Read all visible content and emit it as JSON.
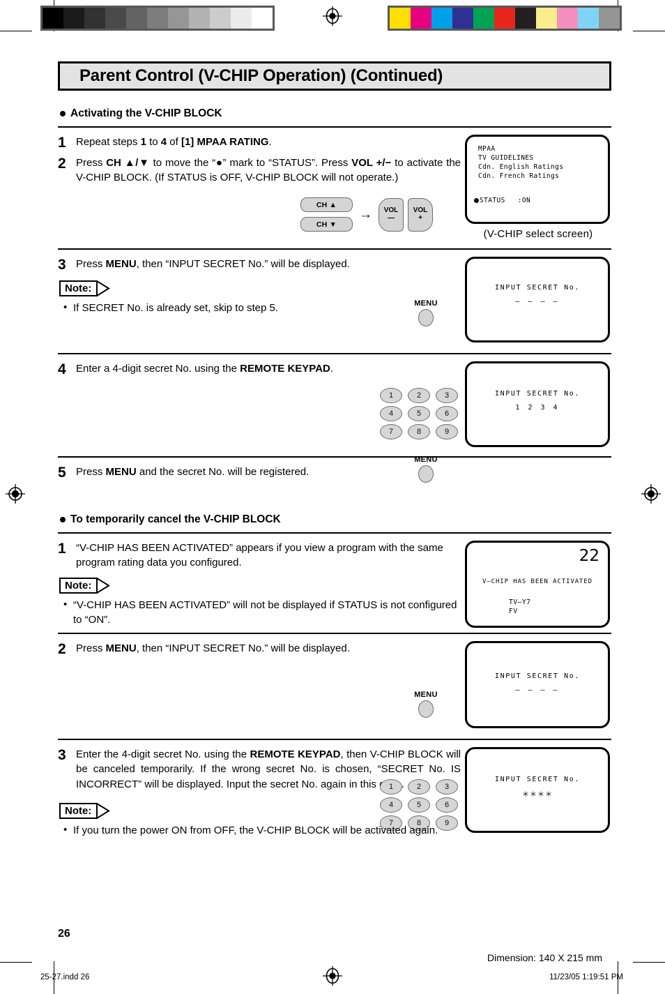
{
  "document": {
    "title": "Parent Control (V-CHIP Operation) (Continued)",
    "page_number": "26",
    "dimension_note": "Dimension: 140  X 215 mm",
    "footer_file": "25-27.indd   26",
    "footer_date": "11/23/05   1:19:51 PM"
  },
  "color_bars": {
    "grayscale": [
      "#000000",
      "#1b1b1b",
      "#323232",
      "#4a4a4a",
      "#636363",
      "#7d7d7d",
      "#969696",
      "#b3b3b3",
      "#cccccc",
      "#ebebeb",
      "#ffffff"
    ],
    "color": [
      "#ffe000",
      "#e6007e",
      "#00a0e9",
      "#2e3192",
      "#00a353",
      "#e8251c",
      "#231f20",
      "#faee8c",
      "#f48fc0",
      "#7fd4f5",
      "#959595"
    ]
  },
  "sections": [
    {
      "heading": "Activating the V-CHIP BLOCK",
      "steps": [
        {
          "number": "1",
          "text_parts": [
            {
              "t": "Repeat steps ",
              "b": false
            },
            {
              "t": "1",
              "b": true
            },
            {
              "t": " to ",
              "b": false
            },
            {
              "t": "4",
              "b": true
            },
            {
              "t": " of ",
              "b": false
            },
            {
              "t": "[1] MPAA RATING",
              "b": true
            },
            {
              "t": ".",
              "b": false
            }
          ]
        },
        {
          "number": "2",
          "text_parts": [
            {
              "t": "Press ",
              "b": false
            },
            {
              "t": "CH ▲/▼",
              "b": true
            },
            {
              "t": " to move the “●” mark to “STATUS”. Press ",
              "b": false
            },
            {
              "t": "VOL +/−",
              "b": true
            },
            {
              "t": "  to activate the V-CHIP BLOCK. (If STATUS is OFF, V-CHIP BLOCK will not operate.)",
              "b": false
            }
          ]
        }
      ],
      "controls": {
        "ch_up_label": "CH ▲",
        "ch_down_label": "CH ▼",
        "arrow": "→",
        "vol_minus_label": "VOL",
        "vol_minus_sign": "—",
        "vol_plus_label": "VOL",
        "vol_plus_sign": "+"
      },
      "screen": {
        "menu_lines": "MPAA\nTV GUIDELINES\nCdn. English Ratings\nCdn. French Ratings",
        "status_label": "STATUS",
        "status_value": ":ON",
        "caption": "(V-CHIP select screen)"
      }
    }
  ],
  "step3": {
    "number": "3",
    "text_parts": [
      {
        "t": "Press ",
        "b": false
      },
      {
        "t": "MENU",
        "b": true
      },
      {
        "t": ", then “INPUT SECRET No.” will be displayed.",
        "b": false
      }
    ],
    "note_label": "Note:",
    "note_items": [
      "If SECRET No. is already set, skip to step 5."
    ],
    "menu_button_label": "MENU",
    "screen": {
      "line1": "INPUT SECRET No.",
      "line2": "– – – –"
    }
  },
  "step4": {
    "number": "4",
    "text_parts": [
      {
        "t": "Enter a 4-digit secret No. using the ",
        "b": false
      },
      {
        "t": "REMOTE KEYPAD",
        "b": true
      },
      {
        "t": ".",
        "b": false
      }
    ],
    "keypad_keys": [
      "1",
      "2",
      "3",
      "4",
      "5",
      "6",
      "7",
      "8",
      "9"
    ],
    "screen": {
      "line1": "INPUT SECRET No.",
      "line2": "1 2 3 4"
    }
  },
  "step5": {
    "number": "5",
    "text_parts": [
      {
        "t": "Press ",
        "b": false
      },
      {
        "t": "MENU",
        "b": true
      },
      {
        "t": " and the secret No. will be registered.",
        "b": false
      }
    ],
    "menu_button_label": "MENU"
  },
  "section2": {
    "heading": "To temporarily cancel the V-CHIP BLOCK"
  },
  "s2step1": {
    "number": "1",
    "text_parts": [
      {
        "t": "“V-CHIP HAS BEEN ACTIVATED” appears if you view a program with the same program rating data you configured.",
        "b": false
      }
    ],
    "note_label": "Note:",
    "note_items": [
      "“V-CHIP HAS BEEN ACTIVATED” will not be displayed if STATUS is not configured to “ON”."
    ],
    "screen": {
      "channel": "22",
      "line1": "V–CHIP HAS BEEN ACTIVATED",
      "line2": "TV–Y7",
      "line3": "FV"
    }
  },
  "s2step2": {
    "number": "2",
    "text_parts": [
      {
        "t": "Press ",
        "b": false
      },
      {
        "t": "MENU",
        "b": true
      },
      {
        "t": ", then “INPUT SECRET No.” will be displayed.",
        "b": false
      }
    ],
    "menu_button_label": "MENU",
    "screen": {
      "line1": "INPUT SECRET No.",
      "line2": "– – – –"
    }
  },
  "s2step3": {
    "number": "3",
    "text_parts": [
      {
        "t": "Enter the 4-digit secret No. using the ",
        "b": false
      },
      {
        "t": "REMOTE KEYPAD",
        "b": true
      },
      {
        "t": ", then V-CHIP BLOCK will be canceled temporarily. If the wrong secret No. is chosen, “SECRET No. IS INCORRECT” will be displayed. Input the secret No. again in this case.",
        "b": false
      }
    ],
    "keypad_keys": [
      "1",
      "2",
      "3",
      "4",
      "5",
      "6",
      "7",
      "8",
      "9"
    ],
    "note_label": "Note:",
    "note_items": [
      "If you turn the power ON from OFF, the V-CHIP BLOCK will be activated again."
    ],
    "screen": {
      "line1": "INPUT SECRET No.",
      "line2": "＊＊＊＊"
    }
  }
}
